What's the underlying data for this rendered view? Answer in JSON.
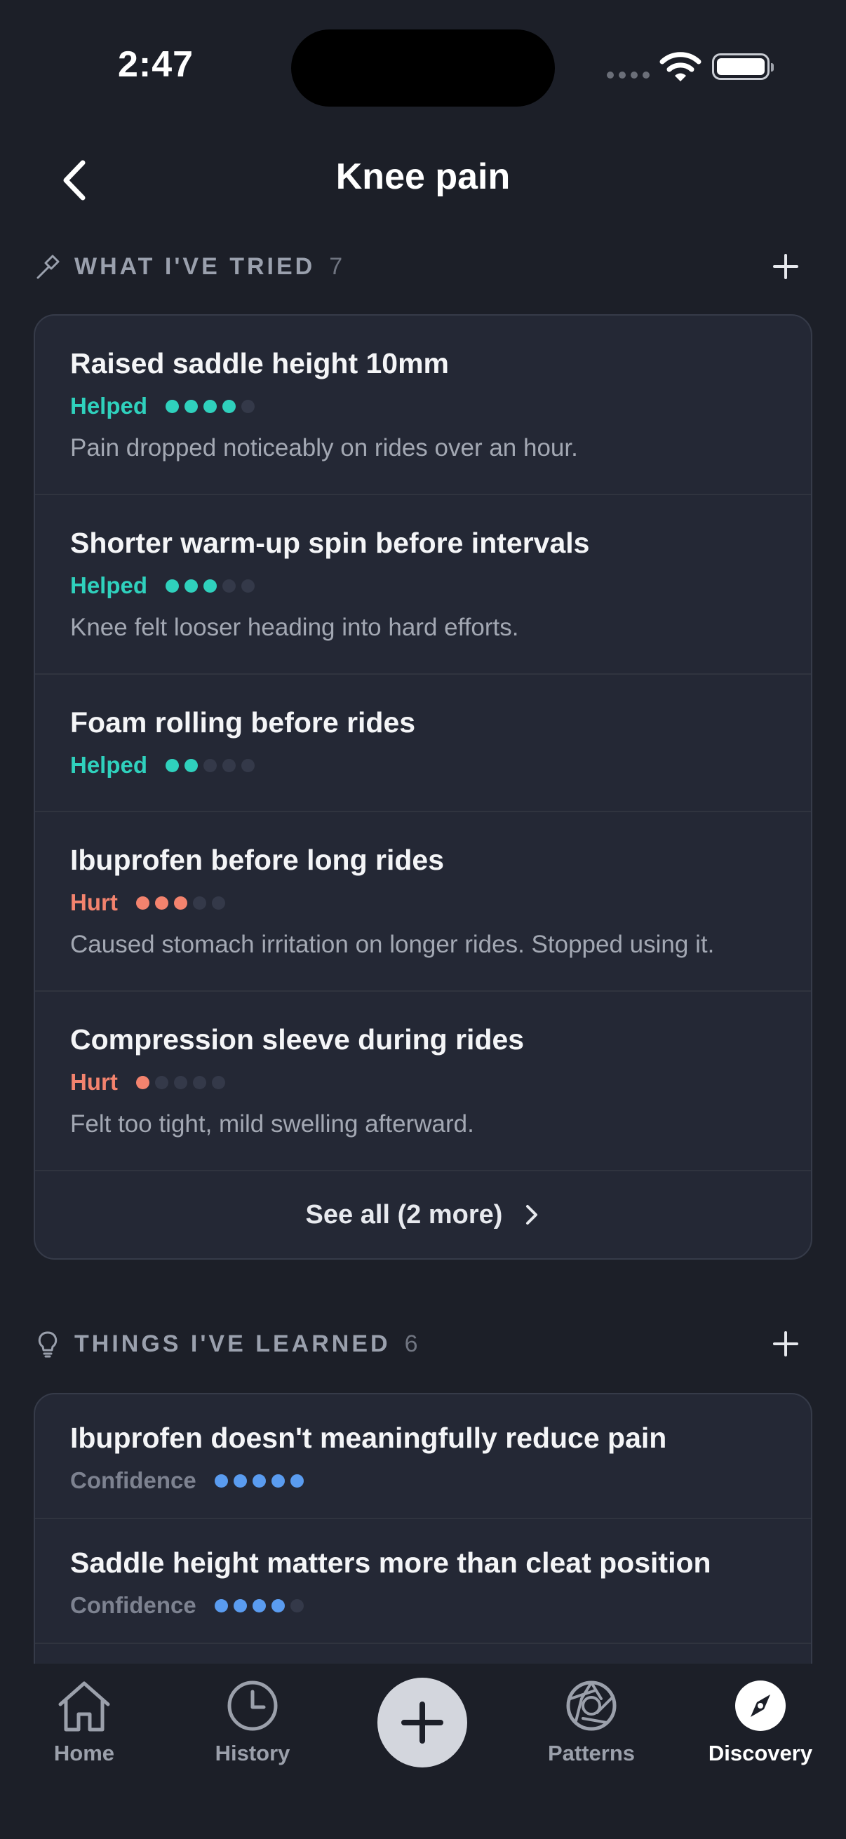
{
  "status": {
    "time": "2:47"
  },
  "header": {
    "title": "Knee pain"
  },
  "tried": {
    "title": "WHAT I'VE TRIED",
    "count": "7",
    "items": [
      {
        "title": "Raised saddle height 10mm",
        "label": "Helped",
        "kind": "helped",
        "rating": 4,
        "note": "Pain dropped noticeably on rides over an hour."
      },
      {
        "title": "Shorter warm-up spin before intervals",
        "label": "Helped",
        "kind": "helped",
        "rating": 3,
        "note": "Knee felt looser heading into hard efforts."
      },
      {
        "title": "Foam rolling before rides",
        "label": "Helped",
        "kind": "helped",
        "rating": 2,
        "note": ""
      },
      {
        "title": "Ibuprofen before long rides",
        "label": "Hurt",
        "kind": "hurt",
        "rating": 3,
        "note": "Caused stomach irritation on longer rides. Stopped using it."
      },
      {
        "title": "Compression sleeve during rides",
        "label": "Hurt",
        "kind": "hurt",
        "rating": 1,
        "note": "Felt too tight, mild swelling afterward."
      }
    ],
    "see_all": "See all (2 more)"
  },
  "learned": {
    "title": "THINGS I'VE LEARNED",
    "count": "6",
    "items": [
      {
        "title": "Ibuprofen doesn't meaningfully reduce pain",
        "label": "Confidence",
        "rating": 5
      },
      {
        "title": "Saddle height matters more than cleat position",
        "label": "Confidence",
        "rating": 4
      }
    ]
  },
  "nav": {
    "home": "Home",
    "history": "History",
    "patterns": "Patterns",
    "discovery": "Discovery"
  },
  "colors": {
    "background": "#1c1f28",
    "card": "#242835",
    "helped": "#2fd1bd",
    "hurt": "#f3836e",
    "confidence": "#5a9cf0",
    "dot_empty": "#343949"
  }
}
